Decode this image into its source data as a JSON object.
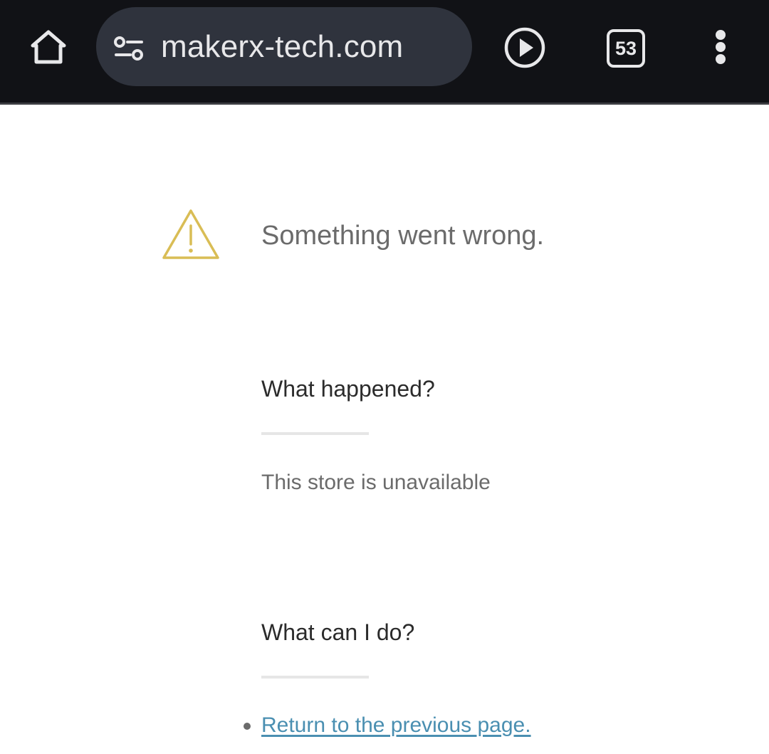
{
  "browser": {
    "url": "makerx-tech.com",
    "tab_count": "53",
    "icons": {
      "home": "home-icon",
      "site_settings": "tune-icon",
      "media": "play-circle-icon",
      "menu": "more-vert-icon"
    },
    "colors": {
      "toolbar_bg": "#111216",
      "omnibox_bg": "#2f333d",
      "icon_fg": "#e8e8ea"
    }
  },
  "error_page": {
    "title": "Something went wrong.",
    "warning_icon": "warning-icon",
    "warning_color": "#d9bd55",
    "sections": [
      {
        "heading": "What happened?",
        "body": "This store is unavailable"
      },
      {
        "heading": "What can I do?",
        "actions": [
          {
            "label": "Return to the previous page."
          }
        ]
      }
    ],
    "link_color": "#4a8fb1"
  }
}
